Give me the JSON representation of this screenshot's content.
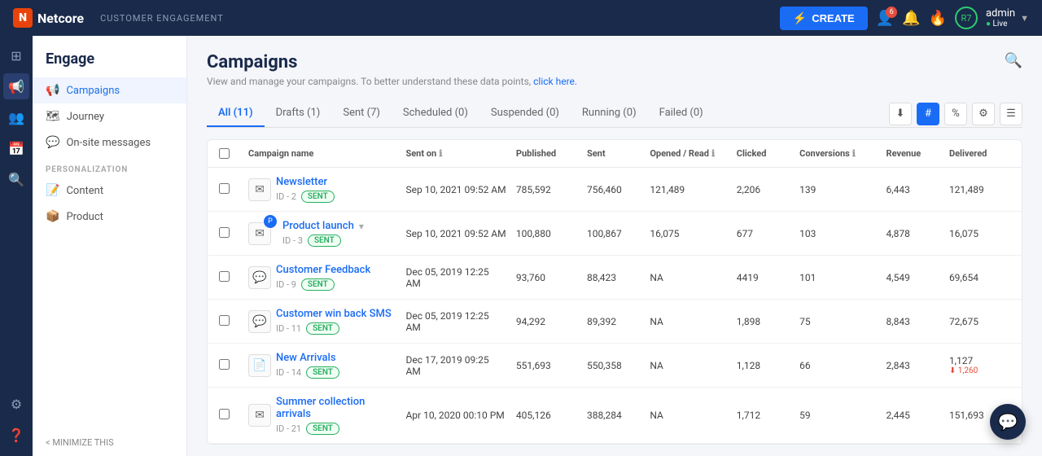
{
  "header": {
    "logo_letter": "N",
    "logo_name": "Netcore",
    "section_label": "CUSTOMER ENGAGEMENT",
    "create_label": "CREATE",
    "admin_label": "admin",
    "admin_status": "Live",
    "notification_count": "6"
  },
  "sidebar": {
    "title": "Engage",
    "items": [
      {
        "id": "campaigns",
        "label": "Campaigns",
        "icon": "📢",
        "active": true
      },
      {
        "id": "journey",
        "label": "Journey",
        "icon": "🗺"
      },
      {
        "id": "onsite",
        "label": "On-site messages",
        "icon": "💬"
      }
    ],
    "personalization_label": "PERSONALIZATION",
    "personalization_items": [
      {
        "id": "content",
        "label": "Content",
        "icon": "📝"
      },
      {
        "id": "product",
        "label": "Product",
        "icon": "📦"
      }
    ],
    "minimize_label": "< MINIMIZE THIS"
  },
  "page": {
    "title": "Campaigns",
    "subtitle": "View and manage your campaigns. To better understand these data points,",
    "subtitle_link": "click here.",
    "search_placeholder": "Search"
  },
  "tabs": [
    {
      "id": "all",
      "label": "All (11)",
      "active": true
    },
    {
      "id": "drafts",
      "label": "Drafts (1)",
      "active": false
    },
    {
      "id": "sent",
      "label": "Sent (7)",
      "active": false
    },
    {
      "id": "scheduled",
      "label": "Scheduled (0)",
      "active": false
    },
    {
      "id": "suspended",
      "label": "Suspended (0)",
      "active": false
    },
    {
      "id": "running",
      "label": "Running (0)",
      "active": false
    },
    {
      "id": "failed",
      "label": "Failed (0)",
      "active": false
    }
  ],
  "table": {
    "columns": [
      {
        "id": "checkbox",
        "label": ""
      },
      {
        "id": "name",
        "label": "Campaign name"
      },
      {
        "id": "sent_on",
        "label": "Sent on",
        "has_info": true
      },
      {
        "id": "published",
        "label": "Published"
      },
      {
        "id": "sent",
        "label": "Sent"
      },
      {
        "id": "opened",
        "label": "Opened / Read",
        "has_info": true
      },
      {
        "id": "clicked",
        "label": "Clicked"
      },
      {
        "id": "conversions",
        "label": "Conversions",
        "has_info": true
      },
      {
        "id": "revenue",
        "label": "Revenue"
      },
      {
        "id": "delivered",
        "label": "Delivered"
      }
    ],
    "rows": [
      {
        "id": "row-1",
        "name": "Newsletter",
        "campaign_id": "ID - 2",
        "status": "SENT",
        "type_icon": "✉",
        "type": "email",
        "has_push": false,
        "expandable": false,
        "sent_on": "Sep 10, 2021 09:52 AM",
        "published": "785,592",
        "sent": "756,460",
        "opened": "121,489",
        "clicked": "2,206",
        "conversions": "139",
        "revenue": "6,443",
        "delivered": "121,489"
      },
      {
        "id": "row-2",
        "name": "Product launch",
        "campaign_id": "ID - 3",
        "status": "SENT",
        "type_icon": "✉",
        "type": "email",
        "has_push": true,
        "expandable": true,
        "sent_on": "Sep 10, 2021 09:52 AM",
        "published": "100,880",
        "sent": "100,867",
        "opened": "16,075",
        "clicked": "677",
        "conversions": "103",
        "revenue": "4,878",
        "delivered": "16,075"
      },
      {
        "id": "row-3",
        "name": "Customer Feedback",
        "campaign_id": "ID - 9",
        "status": "SENT",
        "type_icon": "💬",
        "type": "sms",
        "has_push": false,
        "expandable": false,
        "sent_on": "Dec 05, 2019 12:25 AM",
        "published": "93,760",
        "sent": "88,423",
        "opened": "NA",
        "clicked": "4419",
        "conversions": "101",
        "revenue": "4,549",
        "delivered": "69,654"
      },
      {
        "id": "row-4",
        "name": "Customer win back SMS",
        "campaign_id": "ID - 11",
        "status": "SENT",
        "type_icon": "💬",
        "type": "sms",
        "has_push": false,
        "expandable": false,
        "sent_on": "Dec 05, 2019 12:25 AM",
        "published": "94,292",
        "sent": "89,392",
        "opened": "NA",
        "clicked": "1,898",
        "conversions": "75",
        "revenue": "8,843",
        "delivered": "72,675"
      },
      {
        "id": "row-5",
        "name": "New Arrivals",
        "campaign_id": "ID - 14",
        "status": "SENT",
        "type_icon": "📄",
        "type": "push",
        "has_push": false,
        "expandable": false,
        "sent_on": "Dec 17, 2019 09:25 AM",
        "published": "551,693",
        "sent": "550,358",
        "opened": "NA",
        "clicked": "1,128",
        "conversions": "66",
        "revenue": "2,843",
        "delivered": "1,127",
        "delivered_sub": "⬇ 1,260"
      },
      {
        "id": "row-6",
        "name": "Summer collection arrivals",
        "campaign_id": "ID - 21",
        "status": "SENT",
        "type_icon": "✉",
        "type": "email",
        "has_push": false,
        "expandable": false,
        "sent_on": "Apr 10, 2020 00:10 PM",
        "published": "405,126",
        "sent": "388,284",
        "opened": "NA",
        "clicked": "1,712",
        "conversions": "59",
        "revenue": "2,445",
        "delivered": "151,693"
      }
    ]
  }
}
